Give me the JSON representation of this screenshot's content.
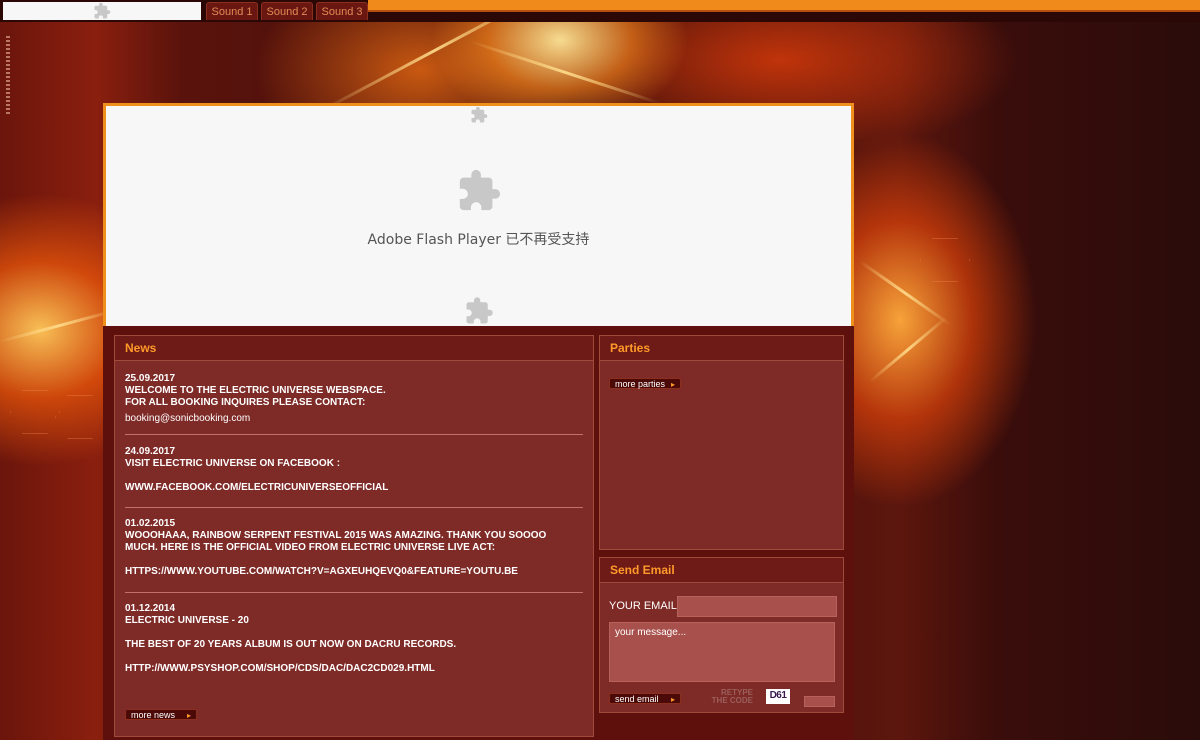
{
  "tabs": {
    "sound1": "Sound 1",
    "sound2": "Sound 2",
    "sound3": "Sound 3"
  },
  "flash": {
    "message": "Adobe Flash Player 已不再受支持"
  },
  "news": {
    "title": "News",
    "items": [
      {
        "date": "25.09.2017",
        "lines": [
          "WELCOME TO THE ELECTRIC UNIVERSE WEBSPACE.",
          "FOR ALL BOOKING INQUIRES PLEASE CONTACT:"
        ],
        "email": "booking@sonicbooking.com"
      },
      {
        "date": "24.09.2017",
        "lines": [
          "VISIT ELECTRIC UNIVERSE ON FACEBOOK :",
          "WWW.FACEBOOK.COM/ELECTRICUNIVERSEOFFICIAL"
        ]
      },
      {
        "date": "01.02.2015",
        "lines": [
          "WOOOHAAA, RAINBOW SERPENT FESTIVAL 2015 WAS AMAZING. THANK YOU SOOOO",
          "MUCH. HERE IS THE OFFICIAL VIDEO FROM ELECTRIC UNIVERSE LIVE ACT:",
          "HTTPS://WWW.YOUTUBE.COM/WATCH?V=AGXEUHQEVQ0&FEATURE=YOUTU.BE"
        ]
      },
      {
        "date": "01.12.2014",
        "lines": [
          "ELECTRIC UNIVERSE - 20",
          "THE BEST OF 20 YEARS ALBUM IS OUT NOW ON DACRU RECORDS.",
          "HTTP://WWW.PSYSHOP.COM/SHOP/CDS/DAC/DAC2CD029.HTML"
        ]
      }
    ],
    "more_label": "more news"
  },
  "parties": {
    "title": "Parties",
    "more_label": "more parties"
  },
  "send_email": {
    "title": "Send Email",
    "email_label": "YOUR EMAIL",
    "message_placeholder": "your message...",
    "send_label": "send email",
    "retype_line1": "RETYPE",
    "retype_line2": "THE CODE",
    "captcha_code": "D61"
  },
  "colors": {
    "accent": "#f08a1a",
    "panel": "#7e2a27",
    "title": "#ff9a2a"
  }
}
